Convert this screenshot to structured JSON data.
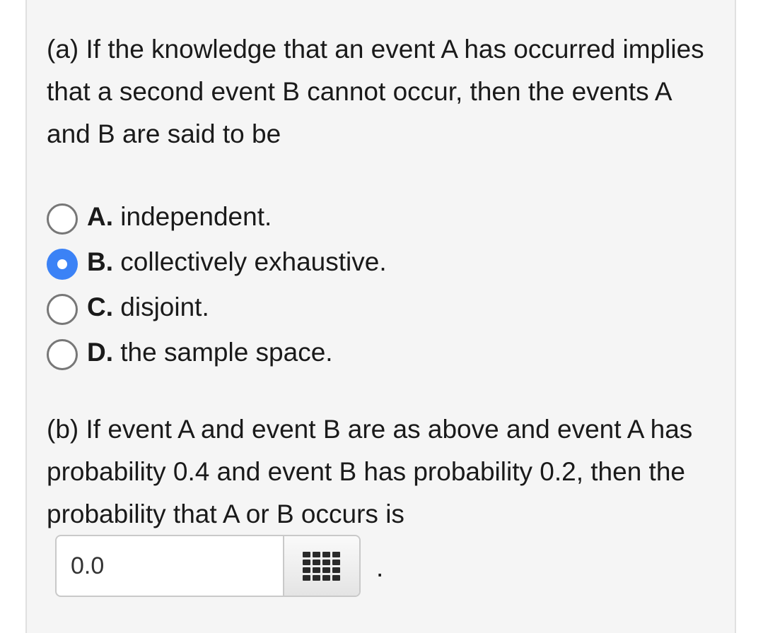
{
  "part_a": {
    "question": "(a) If the knowledge that an event A has occurred implies that a second event B cannot occur, then the events A and B are said to be",
    "options": [
      {
        "letter": "A.",
        "text": " independent."
      },
      {
        "letter": "B.",
        "text": " collectively exhaustive."
      },
      {
        "letter": "C.",
        "text": " disjoint."
      },
      {
        "letter": "D.",
        "text": " the sample space."
      }
    ],
    "selected": "B."
  },
  "part_b": {
    "question": "(b) If event A and event B are as above and event A has probability 0.4 and event B has probability 0.2, then the probability that A or B occurs is",
    "answer_value": "0.0",
    "trailing": "."
  },
  "icons": {
    "keypad": "keypad-grid-icon"
  },
  "colors": {
    "accent": "#3b82f6",
    "panel_bg": "#f5f5f5"
  }
}
